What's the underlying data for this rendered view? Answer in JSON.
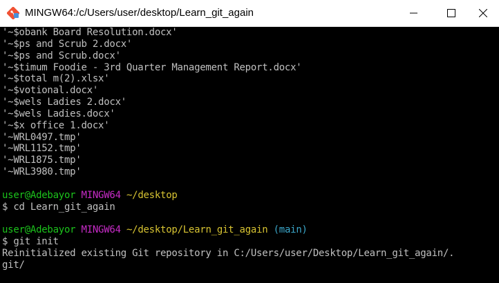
{
  "window": {
    "title": "MINGW64:/c/Users/user/desktop/Learn_git_again",
    "controls": [
      "minimize-icon",
      "maximize-icon",
      "close-icon"
    ]
  },
  "terminal": {
    "listing": [
      "'~$obank Board Resolution.docx'",
      "'~$ps and Scrub 2.docx'",
      "'~$ps and Scrub.docx'",
      "'~$timum Foodie - 3rd Quarter Management Report.docx'",
      "'~$total m(2).xlsx'",
      "'~$votional.docx'",
      "'~$wels Ladies 2.docx'",
      "'~$wels Ladies.docx'",
      "'~$x office 1.docx'",
      "'~WRL0497.tmp'",
      "'~WRL1152.tmp'",
      "'~WRL1875.tmp'",
      "'~WRL3980.tmp'"
    ],
    "prompt1": {
      "user": "user@Adebayor",
      "host": "MINGW64",
      "path": "~/desktop",
      "command": "$ cd Learn_git_again"
    },
    "prompt2": {
      "user": "user@Adebayor",
      "host": "MINGW64",
      "path": "~/desktop/Learn_git_again",
      "branch": "(main)",
      "command": "$ git init"
    },
    "output": [
      "Reinitialized existing Git repository in C:/Users/user/Desktop/Learn_git_again/.",
      "git/"
    ]
  },
  "colors": {
    "background": "#000000",
    "text": "#c0c0c0",
    "user": "#1cc41c",
    "host": "#c72bc7",
    "path": "#d7c332",
    "branch": "#3aa6c9"
  }
}
